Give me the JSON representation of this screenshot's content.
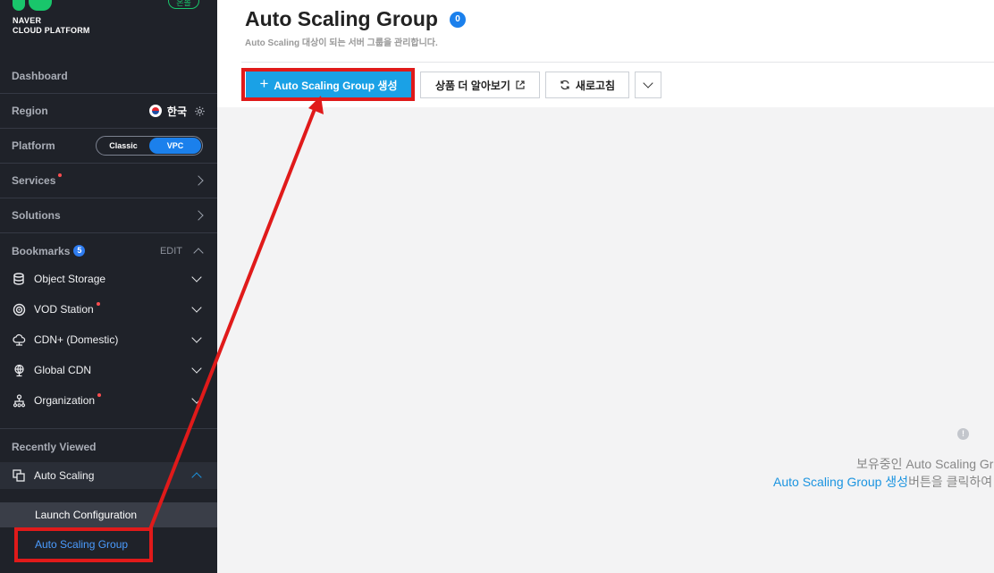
{
  "brand": {
    "line1": "NAVER",
    "line2": "CLOUD PLATFORM",
    "lang_pill": "온볼"
  },
  "sidebar": {
    "dashboard": "Dashboard",
    "region": {
      "label": "Region",
      "value": "한국"
    },
    "platform": {
      "label": "Platform",
      "options": [
        "Classic",
        "VPC"
      ],
      "selected": "VPC"
    },
    "services": "Services",
    "solutions": "Solutions",
    "bookmarks": {
      "label": "Bookmarks",
      "count": "5",
      "edit": "EDIT"
    },
    "bookmark_items": [
      {
        "label": "Object Storage",
        "icon": "database-icon"
      },
      {
        "label": "VOD Station",
        "icon": "vod-icon"
      },
      {
        "label": "CDN+ (Domestic)",
        "icon": "cdn-cloud-icon"
      },
      {
        "label": "Global CDN",
        "icon": "globe-icon"
      },
      {
        "label": "Organization",
        "icon": "organization-icon"
      }
    ],
    "recently_viewed": "Recently Viewed",
    "recent_item": "Auto Scaling",
    "sub_items": [
      "Launch Configuration",
      "Auto Scaling Group"
    ]
  },
  "header": {
    "title": "Auto Scaling Group",
    "count": "0",
    "subtitle": "Auto Scaling 대상이 되는 서버 그룹을 관리합니다."
  },
  "toolbar": {
    "create_label": "Auto Scaling Group 생성",
    "learn_more_label": "상품 더 알아보기",
    "refresh_label": "새로고침"
  },
  "empty_state": {
    "line1": "보유중인 Auto Scaling Gro",
    "link": "Auto Scaling Group 생성",
    "line2_rest": "버튼을 클릭하여 A"
  },
  "colors": {
    "sidebar_bg": "#1f2229",
    "primary": "#1aa1e6",
    "highlight": "#e01a1a",
    "link": "#4b9cff"
  }
}
